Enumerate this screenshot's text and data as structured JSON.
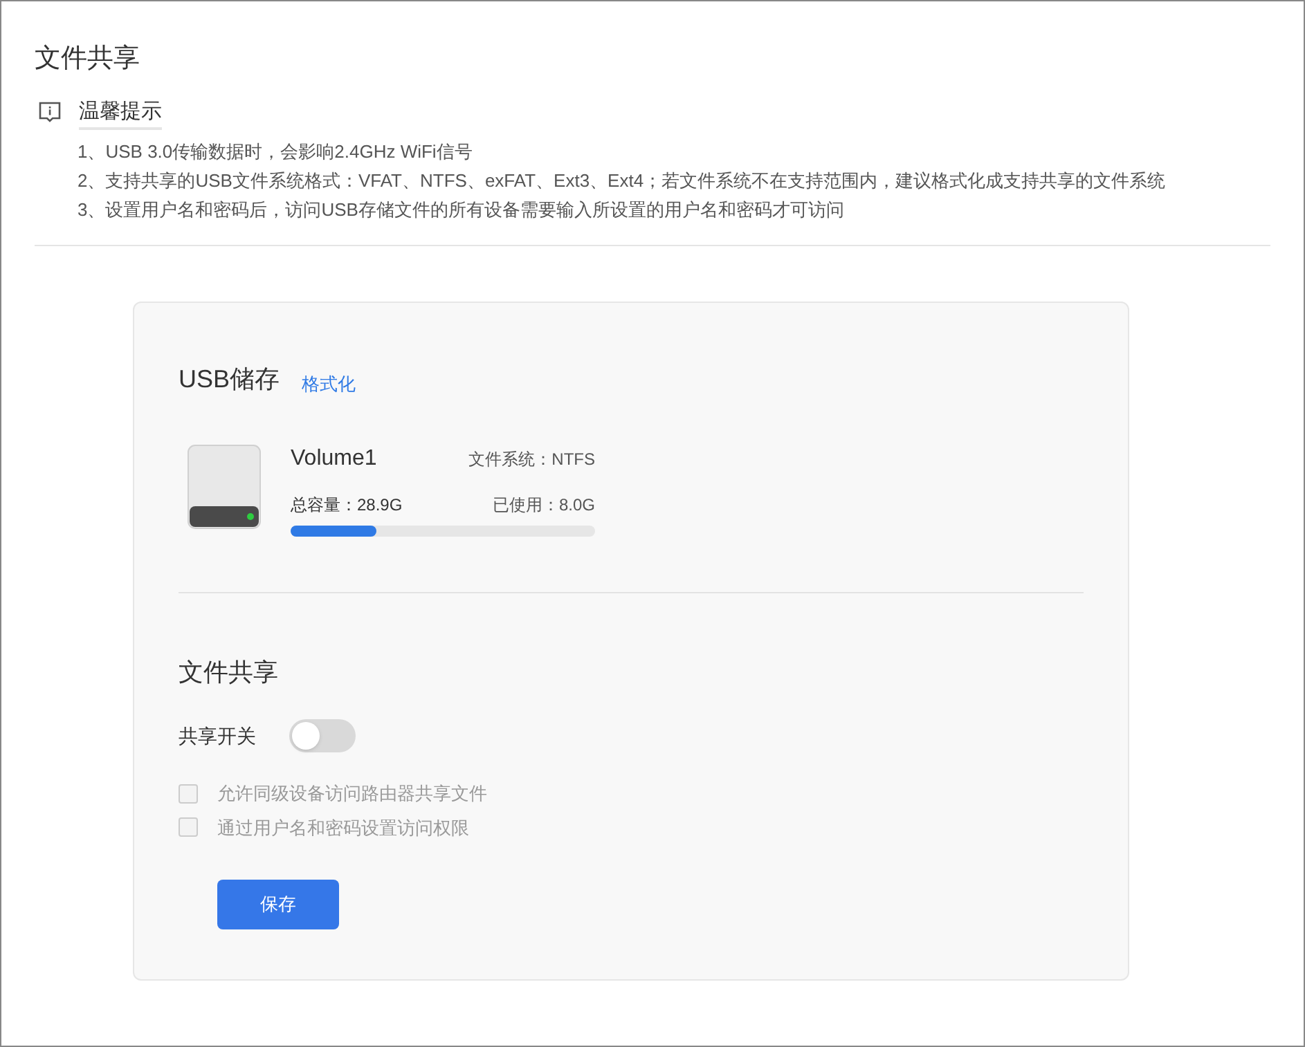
{
  "page_title": "文件共享",
  "tips": {
    "title": "温馨提示",
    "items": [
      "1、USB 3.0传输数据时，会影响2.4GHz WiFi信号",
      "2、支持共享的USB文件系统格式：VFAT、NTFS、exFAT、Ext3、Ext4；若文件系统不在支持范围内，建议格式化成支持共享的文件系统",
      "3、设置用户名和密码后，访问USB存储文件的所有设备需要输入所设置的用户名和密码才可访问"
    ]
  },
  "usb": {
    "title": "USB储存",
    "format_link": "格式化",
    "volume": {
      "name": "Volume1",
      "filesystem": "文件系统：NTFS",
      "total": "总容量：28.9G",
      "used": "已使用：8.0G",
      "level": 0.28
    }
  },
  "sharing": {
    "title": "文件共享",
    "switch_label": "共享开关",
    "on": false,
    "options": [
      {
        "label": "允许同级设备访问路由器共享文件",
        "checked": false,
        "disabled": true
      },
      {
        "label": "通过用户名和密码设置访问权限",
        "checked": false,
        "disabled": true
      }
    ],
    "save": "保存"
  }
}
